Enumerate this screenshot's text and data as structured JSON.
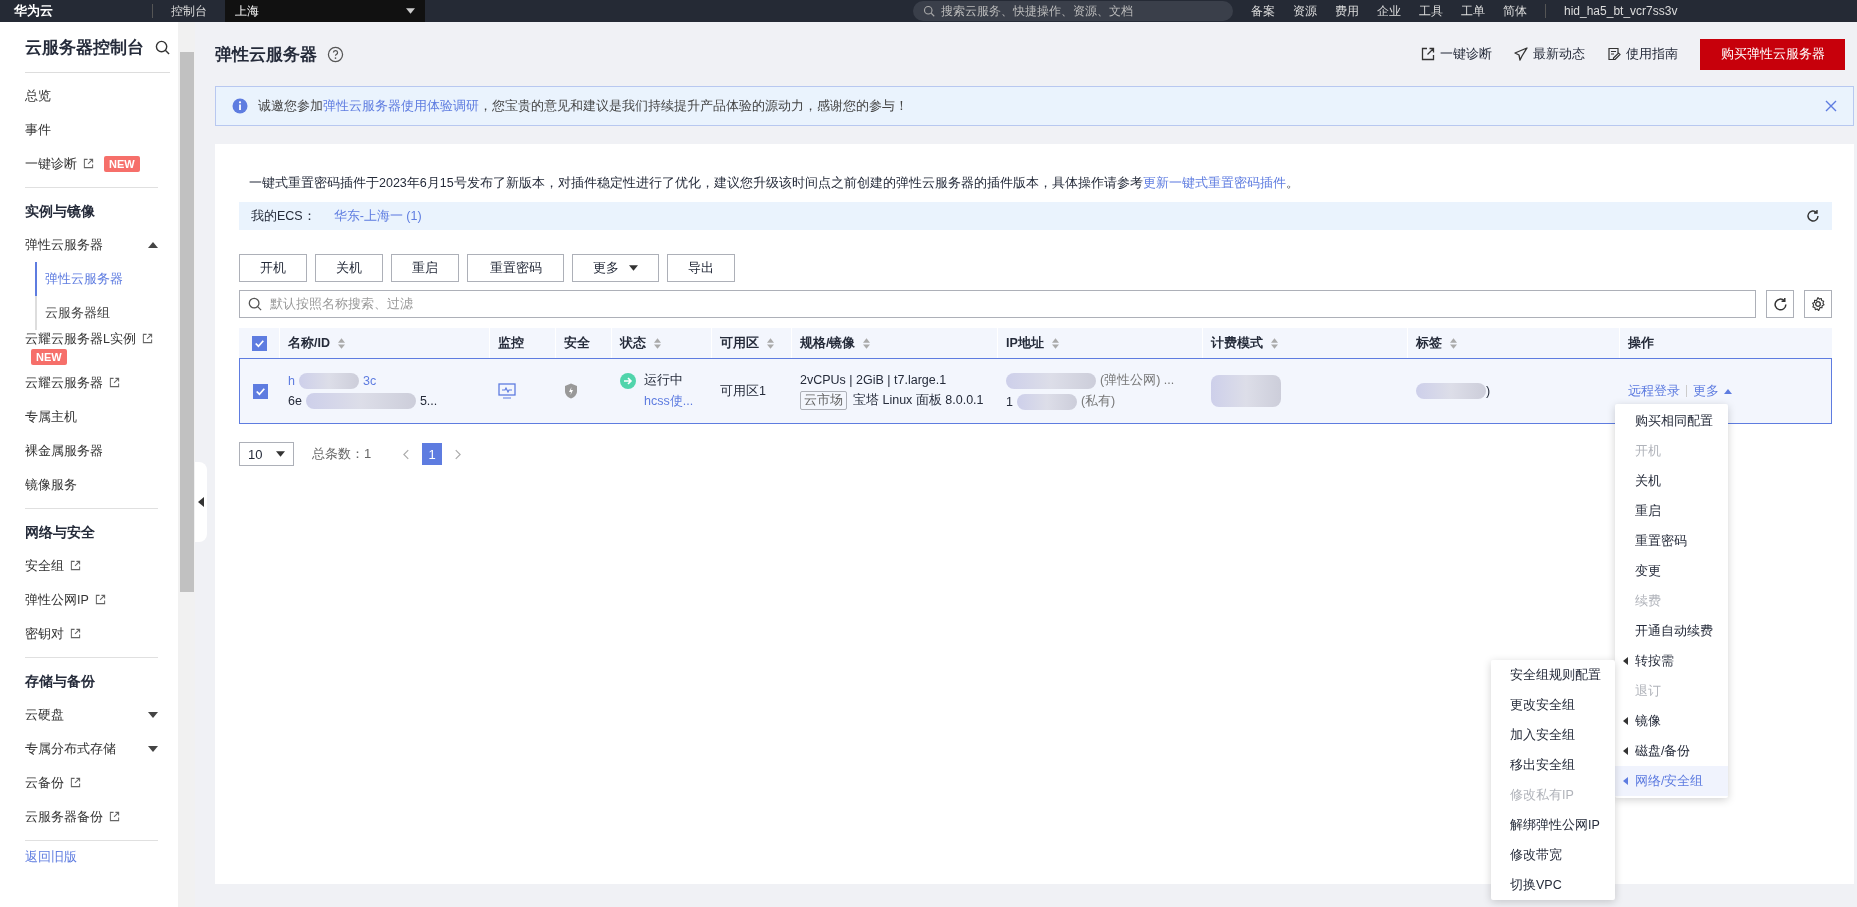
{
  "topbar": {
    "logo": "华为云",
    "console": "控制台",
    "region": "上海",
    "search_placeholder": "搜索云服务、快捷操作、资源、文档",
    "links": [
      "备案",
      "资源",
      "费用",
      "企业",
      "工具",
      "工单"
    ],
    "language": "简体",
    "user": "hid_ha5_bt_vcr7ss3v"
  },
  "sidebar": {
    "title": "云服务器控制台",
    "sections": [
      {
        "items": [
          {
            "label": "总览",
            "external": false
          },
          {
            "label": "事件",
            "external": false
          },
          {
            "label": "一键诊断",
            "external": true,
            "badge": "NEW"
          }
        ]
      },
      {
        "heading": "实例与镜像",
        "items": [
          {
            "label": "弹性云服务器",
            "external": false,
            "expanded": true,
            "children": [
              {
                "label": "弹性云服务器",
                "selected": true
              },
              {
                "label": "云服务器组",
                "selected": false
              }
            ]
          },
          {
            "label": "云耀云服务器L实例",
            "external": true,
            "badge": "NEW"
          },
          {
            "label": "云耀云服务器",
            "external": true
          },
          {
            "label": "专属主机",
            "external": false
          },
          {
            "label": "裸金属服务器",
            "external": false
          },
          {
            "label": "镜像服务",
            "external": false
          }
        ]
      },
      {
        "heading": "网络与安全",
        "items": [
          {
            "label": "安全组",
            "external": true
          },
          {
            "label": "弹性公网IP",
            "external": true
          },
          {
            "label": "密钥对",
            "external": true
          }
        ]
      },
      {
        "heading": "存储与备份",
        "items": [
          {
            "label": "云硬盘",
            "external": false,
            "expanded": false
          },
          {
            "label": "专属分布式存储",
            "external": false,
            "expanded": false
          },
          {
            "label": "云备份",
            "external": true
          },
          {
            "label": "云服务器备份",
            "external": true
          }
        ]
      }
    ],
    "footer_link": "返回旧版"
  },
  "header": {
    "title": "弹性云服务器",
    "actions": [
      {
        "label": "一键诊断",
        "kind": "diagnose"
      },
      {
        "label": "最新动态",
        "kind": "news"
      },
      {
        "label": "使用指南",
        "kind": "guide"
      }
    ],
    "buy_button": "购买弹性云服务器"
  },
  "banner": {
    "pre": "诚邀您参加",
    "link": "弹性云服务器使用体验调研",
    "post": "，您宝贵的意见和建议是我们持续提升产品体验的源动力，感谢您的参与！"
  },
  "notice": {
    "pre": "一键式重置密码插件于2023年6月15号发布了新版本，对插件稳定性进行了优化，建议您升级该时间点之前创建的弹性云服务器的插件版本，具体操作请参考",
    "link": "更新一键式重置密码插件",
    "post": "。"
  },
  "region_bar": {
    "label": "我的ECS：",
    "link": "华东-上海一 (1)"
  },
  "toolbar": [
    {
      "label": "开机",
      "dropdown": false
    },
    {
      "label": "关机",
      "dropdown": false
    },
    {
      "label": "重启",
      "dropdown": false
    },
    {
      "label": "重置密码",
      "dropdown": false
    },
    {
      "label": "更多",
      "dropdown": true
    },
    {
      "label": "导出",
      "dropdown": false
    }
  ],
  "search": {
    "placeholder": "默认按照名称搜索、过滤"
  },
  "table": {
    "all_checked": true,
    "columns": [
      {
        "label": "名称/ID",
        "sortable": true
      },
      {
        "label": "监控",
        "sortable": false
      },
      {
        "label": "安全",
        "sortable": false
      },
      {
        "label": "状态",
        "sortable": true
      },
      {
        "label": "可用区",
        "sortable": true
      },
      {
        "label": "规格/镜像",
        "sortable": true
      },
      {
        "label": "IP地址",
        "sortable": true
      },
      {
        "label": "计费模式",
        "sortable": true
      },
      {
        "label": "标签",
        "sortable": true
      },
      {
        "label": "操作",
        "sortable": false
      }
    ],
    "rows": [
      {
        "checked": true,
        "selected": true,
        "name_start": "h",
        "name_end": "3c",
        "id_start": "6e",
        "id_end": "5...",
        "status": "运行中",
        "status_note": "hcss使...",
        "zone": "可用区1",
        "spec": "2vCPUs | 2GiB | t7.large.1",
        "image_tag": "云市场",
        "image": "宝塔 Linux 面板 8.0.0.1",
        "ip_public": "(弹性公网) ...",
        "ip_private_start": "1",
        "ip_private": "(私有)",
        "tag_end": ")",
        "actions": [
          "远程登录",
          "更多"
        ]
      }
    ]
  },
  "pagination": {
    "page_size": "10",
    "total": "总条数：1",
    "pages": [
      {
        "label": "1",
        "selected": true
      }
    ]
  },
  "more_menu": {
    "items": [
      {
        "label": "购买相同配置",
        "disabled": false,
        "submenu": false,
        "selected": false
      },
      {
        "label": "开机",
        "disabled": true,
        "submenu": false,
        "selected": false
      },
      {
        "label": "关机",
        "disabled": false,
        "submenu": false,
        "selected": false
      },
      {
        "label": "重启",
        "disabled": false,
        "submenu": false,
        "selected": false
      },
      {
        "label": "重置密码",
        "disabled": false,
        "submenu": false,
        "selected": false
      },
      {
        "label": "变更",
        "disabled": false,
        "submenu": false,
        "selected": false
      },
      {
        "label": "续费",
        "disabled": true,
        "submenu": false,
        "selected": false
      },
      {
        "label": "开通自动续费",
        "disabled": false,
        "submenu": false,
        "selected": false
      },
      {
        "label": "转按需",
        "disabled": false,
        "submenu": true,
        "selected": false
      },
      {
        "label": "退订",
        "disabled": true,
        "submenu": false,
        "selected": false
      },
      {
        "label": "镜像",
        "disabled": false,
        "submenu": true,
        "selected": false
      },
      {
        "label": "磁盘/备份",
        "disabled": false,
        "submenu": true,
        "selected": false
      },
      {
        "label": "网络/安全组",
        "disabled": false,
        "submenu": true,
        "selected": true
      }
    ],
    "submenu": [
      {
        "label": "安全组规则配置",
        "disabled": false
      },
      {
        "label": "更改安全组",
        "disabled": false
      },
      {
        "label": "加入安全组",
        "disabled": false
      },
      {
        "label": "移出安全组",
        "disabled": false
      },
      {
        "label": "修改私有IP",
        "disabled": true
      },
      {
        "label": "解绑弹性公网IP",
        "disabled": false
      },
      {
        "label": "修改带宽",
        "disabled": false
      },
      {
        "label": "切换VPC",
        "disabled": false
      }
    ]
  }
}
